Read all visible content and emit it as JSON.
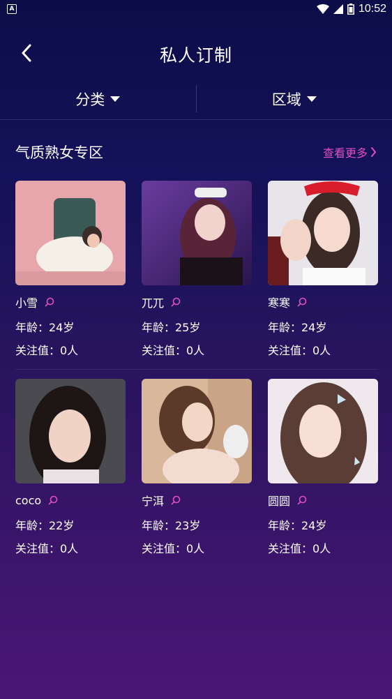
{
  "status_bar": {
    "time": "10:52",
    "notification_icon": "A"
  },
  "header": {
    "title": "私人订制",
    "back_icon": "chevron-left-icon"
  },
  "filters": [
    {
      "label": "分类"
    },
    {
      "label": "区域"
    }
  ],
  "section": {
    "title": "气质熟女专区",
    "more_label": "查看更多"
  },
  "profiles": [
    {
      "name": "小雪",
      "age": "年龄：24岁",
      "followers": "关注值：0人"
    },
    {
      "name": "兀兀",
      "age": "年龄：25岁",
      "followers": "关注值：0人"
    },
    {
      "name": "寒寒",
      "age": "年龄：24岁",
      "followers": "关注值：0人"
    },
    {
      "name": "coco",
      "age": "年龄：22岁",
      "followers": "关注值：0人"
    },
    {
      "name": "宁洱",
      "age": "年龄：23岁",
      "followers": "关注值：0人"
    },
    {
      "name": "圆圆",
      "age": "年龄：24岁",
      "followers": "关注值：0人"
    }
  ],
  "colors": {
    "accent": "#e14fbf",
    "bg_top": "#0b0d48",
    "bg_bottom": "#4a1675"
  }
}
